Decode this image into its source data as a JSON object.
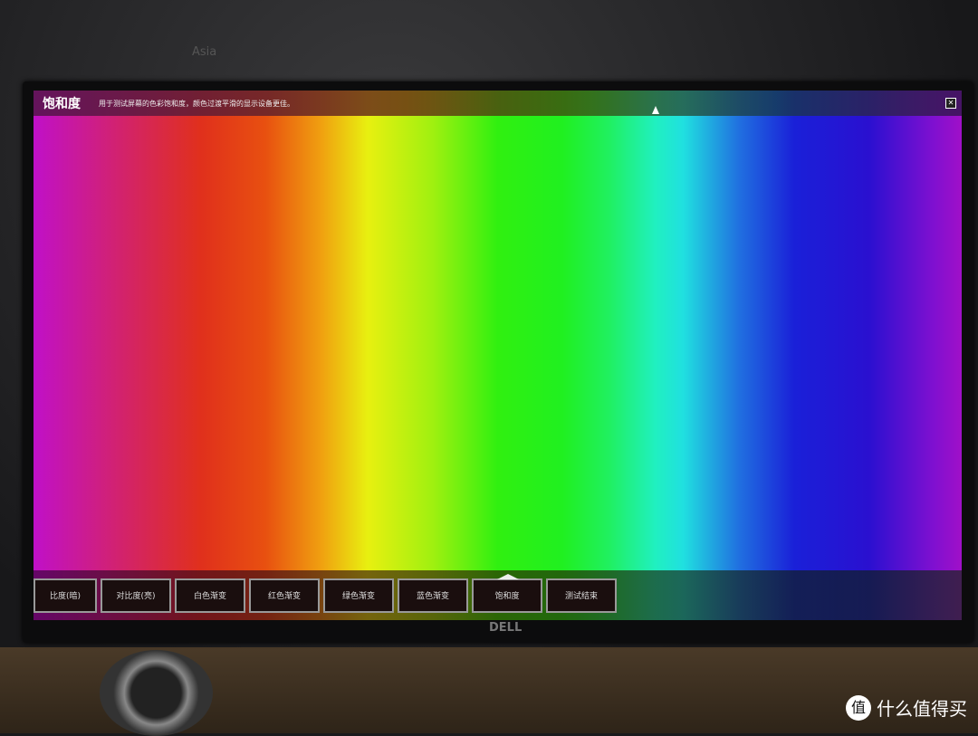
{
  "background": {
    "wall_text": "Asia"
  },
  "window": {
    "title": "饱和度",
    "description": "用于测试屏幕的色彩饱和度，颜色过渡平滑的显示设备更佳。",
    "close_icon": "close-icon"
  },
  "tabs": [
    {
      "label": "比度(暗)"
    },
    {
      "label": "对比度(亮)"
    },
    {
      "label": "白色渐变"
    },
    {
      "label": "红色渐变"
    },
    {
      "label": "绿色渐变"
    },
    {
      "label": "蓝色渐变"
    },
    {
      "label": "饱和度",
      "active": true
    },
    {
      "label": "测试结束"
    }
  ],
  "monitor": {
    "brand": "DELL"
  },
  "watermark": {
    "icon": "值",
    "text": "什么值得买"
  }
}
